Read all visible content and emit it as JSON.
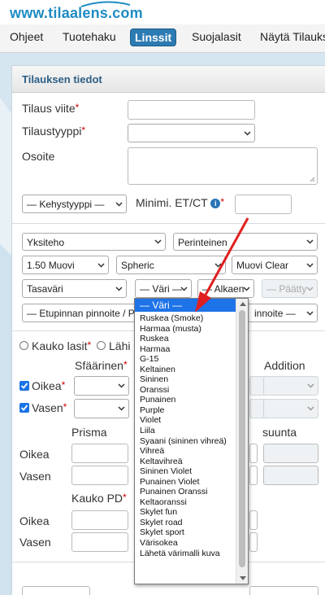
{
  "site": {
    "logo_text": "www.tilaalens.com"
  },
  "nav": {
    "items": [
      {
        "label": "Ohjeet"
      },
      {
        "label": "Tuotehaku"
      },
      {
        "label": "Linssit"
      },
      {
        "label": "Suojalasit"
      },
      {
        "label": "Näytä Tilauks"
      }
    ],
    "active_index": 2
  },
  "panel": {
    "title": "Tilauksen tiedot"
  },
  "form": {
    "tilaus_viite_label": "Tilaus viite",
    "tilaustyyppi_label": "Tilaustyyppi",
    "osoite_label": "Osoite",
    "kehystyyppi_value": "— Kehystyyppi —",
    "minimi_label": "Minimi. ET/CT",
    "required_mark": "*",
    "info_glyph": "i",
    "row1": {
      "vision": "Yksiteho",
      "design": "Perinteinen"
    },
    "row2": {
      "material": "1.50 Muovi",
      "geometry": "Spheric",
      "tint": "Muovi Clear"
    },
    "row3": {
      "color_type": "Tasaväri",
      "color": "— Väri —",
      "start": "— Alkaen",
      "end": "— Päätty"
    },
    "row4": {
      "front_coating": "— Etupinnan pinnoite / Pei",
      "back_coating": "innoite —"
    },
    "distance_label": "Kauko lasit",
    "near_label": "Lähi l",
    "sphere_header": "Sfäärinen",
    "addition_header": "Addition",
    "right_label": "Oikea",
    "left_label": "Vasen",
    "prism_header": "Prisma",
    "direction_header": "suunta",
    "prism_right_label": "Oikea",
    "prism_left_label": "Vasen",
    "pd_header": "Kauko PD",
    "pd_right_label": "Oikea",
    "pd_left_label": "Vasen"
  },
  "color_dropdown": {
    "selected": "— Väri —",
    "options": [
      "Ruskea (Smoke)",
      "Harmaa (musta)",
      "Ruskea",
      "Harmaa",
      "G-15",
      "Keltainen",
      "Sininen",
      "Oranssi",
      "Punainen",
      "Purple",
      "Violet",
      "Liila",
      "Syaani (sininen vihreä)",
      "Vihreä",
      "Keltavihreä",
      "Sininen Violet",
      "Punainen Violet",
      "Punainen Oranssi",
      "Keltaoranssi",
      "Skylet fun",
      "Skylet road",
      "Skylet sport",
      "Värisokea",
      "Lähetä värimalli kuva"
    ]
  },
  "colors": {
    "accent": "#2d7bb3",
    "logo": "#1e8cc4",
    "panel_title": "#2d5f86",
    "annotation_arrow": "#e02020",
    "selection": "#1e73e8"
  }
}
